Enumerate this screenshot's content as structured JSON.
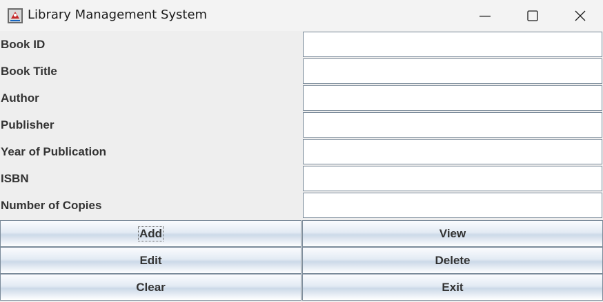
{
  "window": {
    "title": "Library Management System"
  },
  "titlebar": {
    "controls": [
      {
        "icon": "minimize-icon"
      },
      {
        "icon": "maximize-icon"
      },
      {
        "icon": "close-icon"
      }
    ]
  },
  "form": {
    "fields": [
      {
        "label": "Book ID",
        "value": ""
      },
      {
        "label": "Book Title",
        "value": ""
      },
      {
        "label": "Author",
        "value": ""
      },
      {
        "label": "Publisher",
        "value": ""
      },
      {
        "label": "Year of Publication",
        "value": ""
      },
      {
        "label": "ISBN",
        "value": ""
      },
      {
        "label": "Number of Copies",
        "value": ""
      }
    ]
  },
  "buttons": {
    "add": "Add",
    "view": "View",
    "edit": "Edit",
    "delete": "Delete",
    "clear": "Clear",
    "exit": "Exit"
  },
  "colors": {
    "field_border": "#7a8a99",
    "background": "#eeeeee",
    "label_text": "#333333"
  }
}
